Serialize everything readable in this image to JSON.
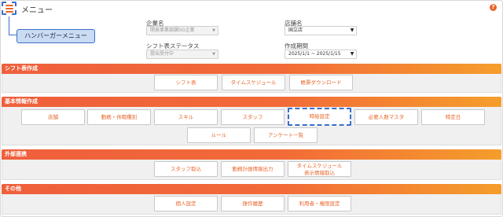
{
  "header": {
    "title": "メニュー",
    "menu_icon": "hamburger-icon",
    "help_icon": "?",
    "callout": "ハンバーガーメニュー"
  },
  "filters": {
    "company_label": "企業名",
    "company_value": "開発事業部課SG企業",
    "store_label": "店舗名",
    "store_value": "国立店",
    "status_label": "シフト表ステータス",
    "status_value": "提出受付中",
    "period_label": "作成期間",
    "period_value": "2025/1/1 ~ 2025/1/15"
  },
  "sections": {
    "shift": {
      "title": "シフト表作成",
      "buttons": [
        "シフト表",
        "タイムスケジュール",
        "帳票ダウンロード"
      ]
    },
    "basic": {
      "title": "基本情報作成",
      "buttons": [
        "店舗",
        "勤務・休暇種別",
        "スキル",
        "スタッフ",
        "時給設定",
        "必要人数マスタ",
        "特定日",
        "ルール",
        "アンケート一覧"
      ]
    },
    "external": {
      "title": "外部連携",
      "buttons": [
        "スタッフ取込",
        "勤務計画情報出力"
      ],
      "timeschedule_line1": "タイムスケジュール",
      "timeschedule_line2": "表示情報取込"
    },
    "other": {
      "title": "その他",
      "buttons": [
        "個人設定",
        "操作履歴",
        "利用者・権限設定"
      ]
    }
  },
  "colors": {
    "accent": "#e8652a",
    "header_gradient_start": "#ef5f3c",
    "header_gradient_end": "#f59d2c",
    "highlight": "#3a6fc9"
  }
}
